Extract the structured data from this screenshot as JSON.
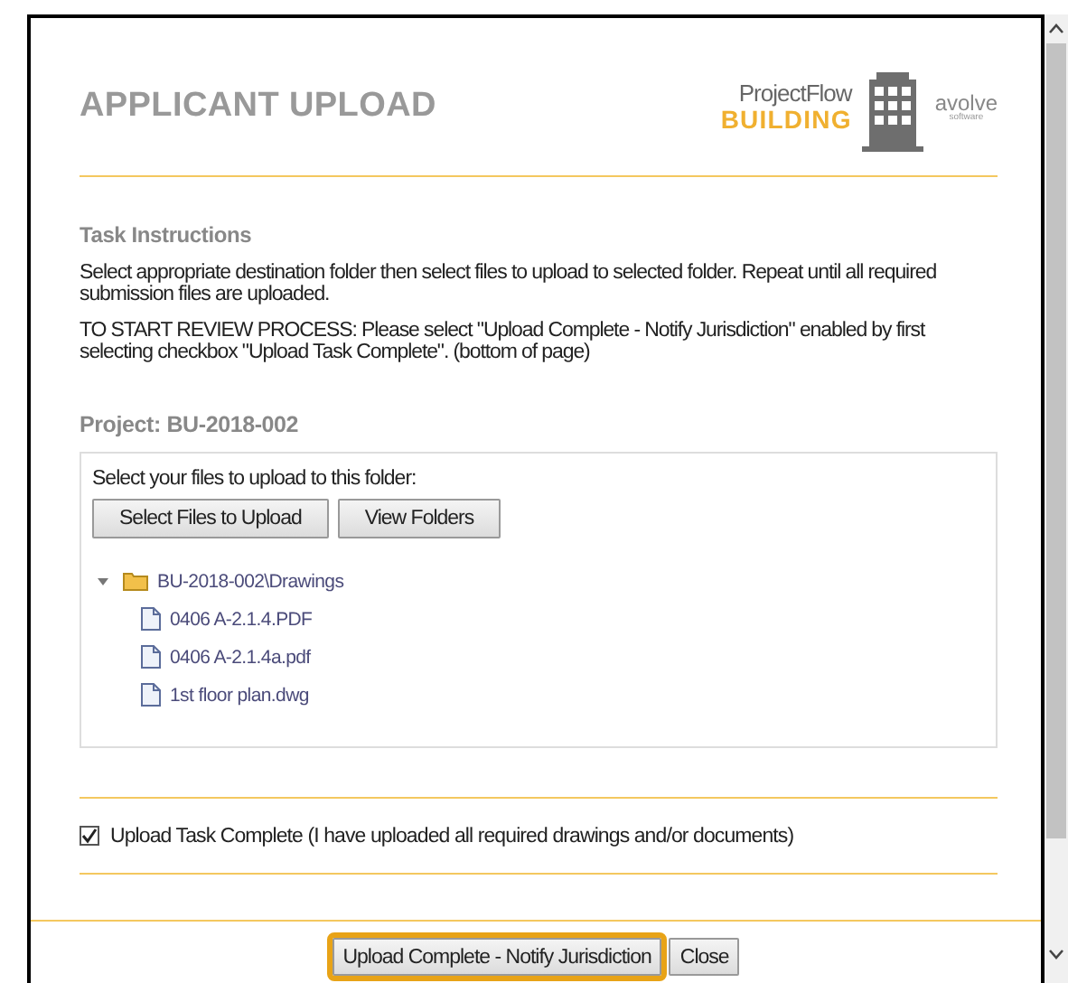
{
  "header": {
    "title": "APPLICANT UPLOAD",
    "logo": {
      "product": "ProjectFlow",
      "product_line": "BUILDING",
      "vendor": "avolve",
      "vendor_tagline": "software"
    }
  },
  "instructions": {
    "heading": "Task Instructions",
    "paragraphs": [
      "Select appropriate destination folder then select files to upload to selected folder. Repeat until all required submission files are uploaded.",
      "TO START REVIEW PROCESS: Please select \"Upload Complete - Notify Jurisdiction\" enabled by first selecting checkbox \"Upload Task Complete\". (bottom of page)"
    ]
  },
  "project": {
    "label": "Project: BU-2018-002"
  },
  "upload_panel": {
    "prompt": "Select your files to upload to this folder:",
    "buttons": [
      "Select Files to Upload",
      "View Folders"
    ],
    "tree": [
      {
        "label": "BU-2018-002\\Drawings",
        "kind": "folder",
        "expanded": true,
        "children": [
          {
            "label": "0406 A-2.1.4.PDF",
            "kind": "file"
          },
          {
            "label": "0406 A-2.1.4a.pdf",
            "kind": "file"
          },
          {
            "label": "1st floor plan.dwg",
            "kind": "file"
          }
        ]
      }
    ]
  },
  "completion": {
    "label": "Upload Task Complete (I have uploaded all required drawings and/or documents)",
    "checked": true
  },
  "footer": {
    "buttons": [
      {
        "label": "Upload Complete - Notify Jurisdiction",
        "focused": true
      },
      {
        "label": "Close",
        "focused": false
      }
    ]
  }
}
